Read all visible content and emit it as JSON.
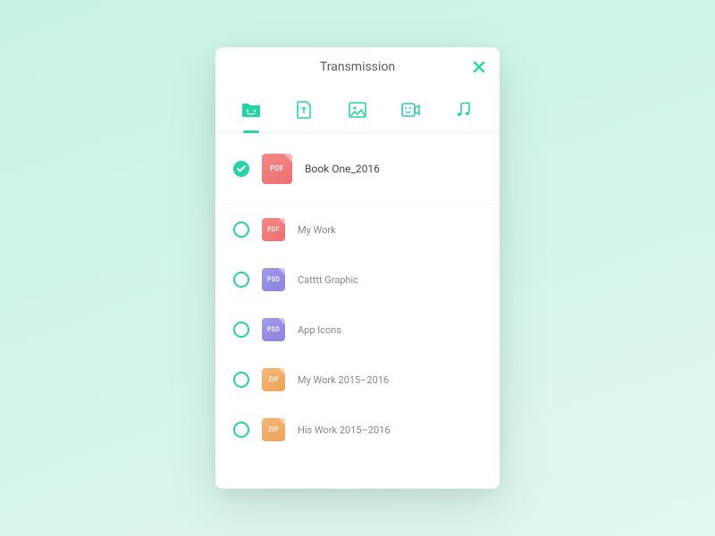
{
  "title": "Transmission",
  "tabs": [
    {
      "id": "folder",
      "active": true
    },
    {
      "id": "text",
      "active": false
    },
    {
      "id": "image",
      "active": false
    },
    {
      "id": "video",
      "active": false
    },
    {
      "id": "music",
      "active": false
    }
  ],
  "files": [
    {
      "name": "Book One_2016",
      "type": "PDF",
      "typeClass": "pdf",
      "selected": true
    },
    {
      "name": "My Work",
      "type": "PDF",
      "typeClass": "pdf",
      "selected": false
    },
    {
      "name": "Catttt Graphic",
      "type": "PSD",
      "typeClass": "psd",
      "selected": false
    },
    {
      "name": "App Icons",
      "type": "PSD",
      "typeClass": "psd",
      "selected": false
    },
    {
      "name": "My Work 2015–2016",
      "type": "ZIP",
      "typeClass": "zip",
      "selected": false
    },
    {
      "name": "His Work 2015–2016",
      "type": "ZIP",
      "typeClass": "zip",
      "selected": false
    }
  ],
  "colors": {
    "accent": "#25d3a5",
    "pdf": "#ee6e6e",
    "psd": "#8c81e0",
    "zip": "#eea35a"
  }
}
